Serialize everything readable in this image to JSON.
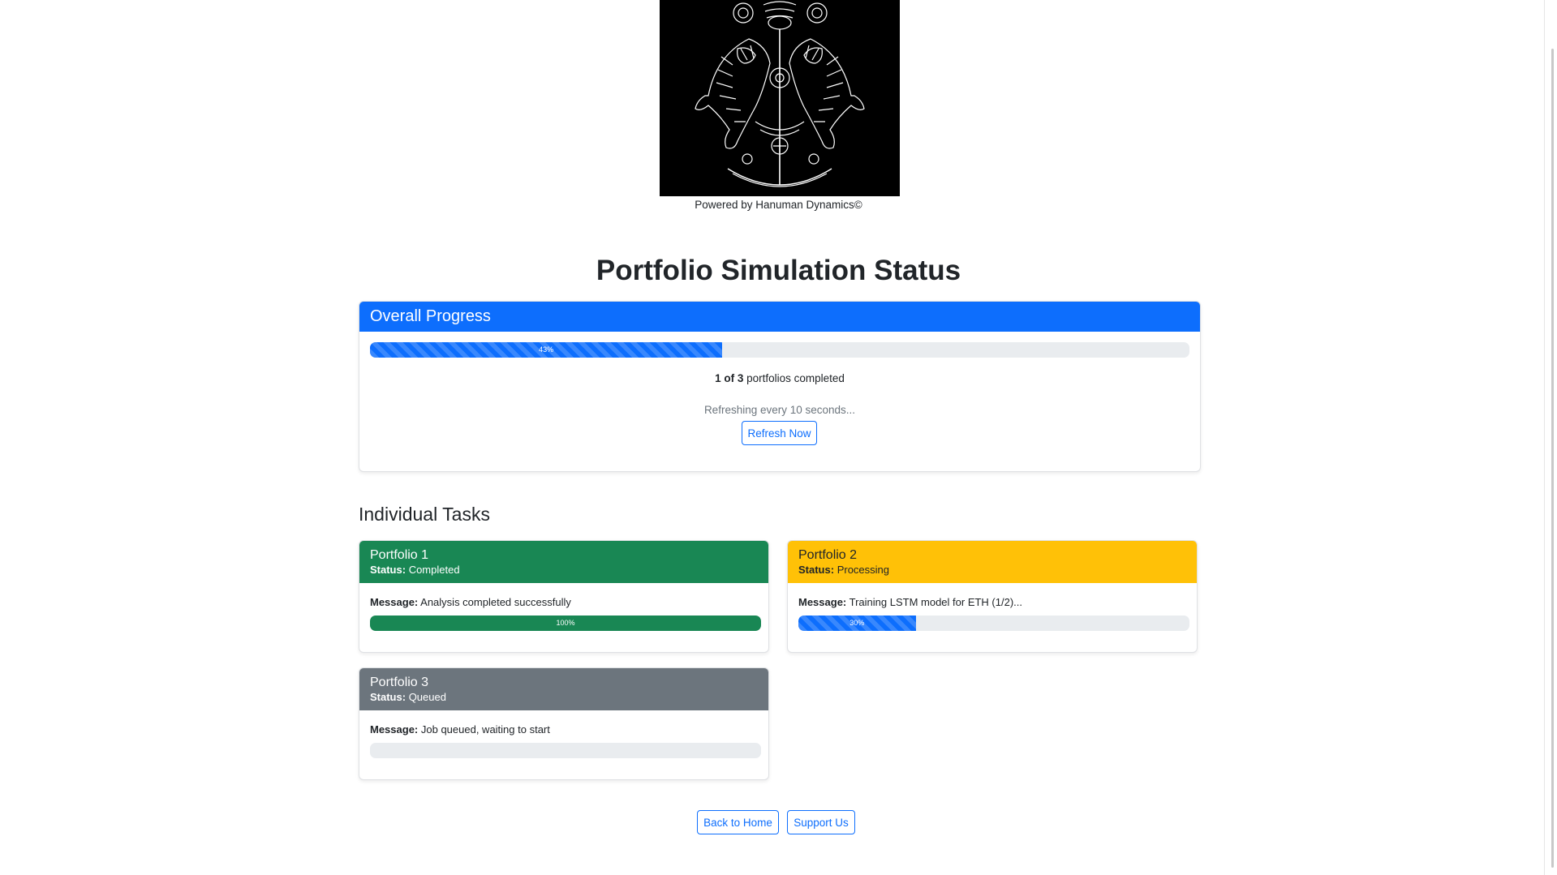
{
  "brand": {
    "powered_by": "Powered by Hanuman Dynamics©"
  },
  "page": {
    "title": "Portfolio Simulation Status"
  },
  "overall": {
    "header": "Overall Progress",
    "progress_percent": 43,
    "progress_label": "43%",
    "completed_count": "1 of 3",
    "completed_suffix": "portfolios completed",
    "refresh_text": "Refreshing every 10 seconds...",
    "refresh_button": "Refresh Now"
  },
  "tasks_section": {
    "title": "Individual Tasks",
    "status_label": "Status:",
    "message_label": "Message:"
  },
  "tasks": [
    {
      "name": "Portfolio 1",
      "status": "Completed",
      "message": "Analysis completed successfully",
      "progress_percent": 100,
      "progress_label": "100%",
      "header_color": "#198754",
      "bar_color": "#198754"
    },
    {
      "name": "Portfolio 2",
      "status": "Processing",
      "message": "Training LSTM model for ETH (1/2)...",
      "progress_percent": 30,
      "progress_label": "30%",
      "header_color": "#ffc107",
      "bar_color": "#0d6efd"
    },
    {
      "name": "Portfolio 3",
      "status": "Queued",
      "message": "Job queued, waiting to start",
      "progress_percent": 0,
      "progress_label": "",
      "header_color": "#6c757d",
      "bar_color": "#0d6efd"
    }
  ],
  "footer": {
    "back_home": "Back to Home",
    "support": "Support Us"
  },
  "colors": {
    "primary": "#0d6efd",
    "success": "#198754",
    "warning": "#ffc107",
    "secondary": "#6c757d"
  }
}
